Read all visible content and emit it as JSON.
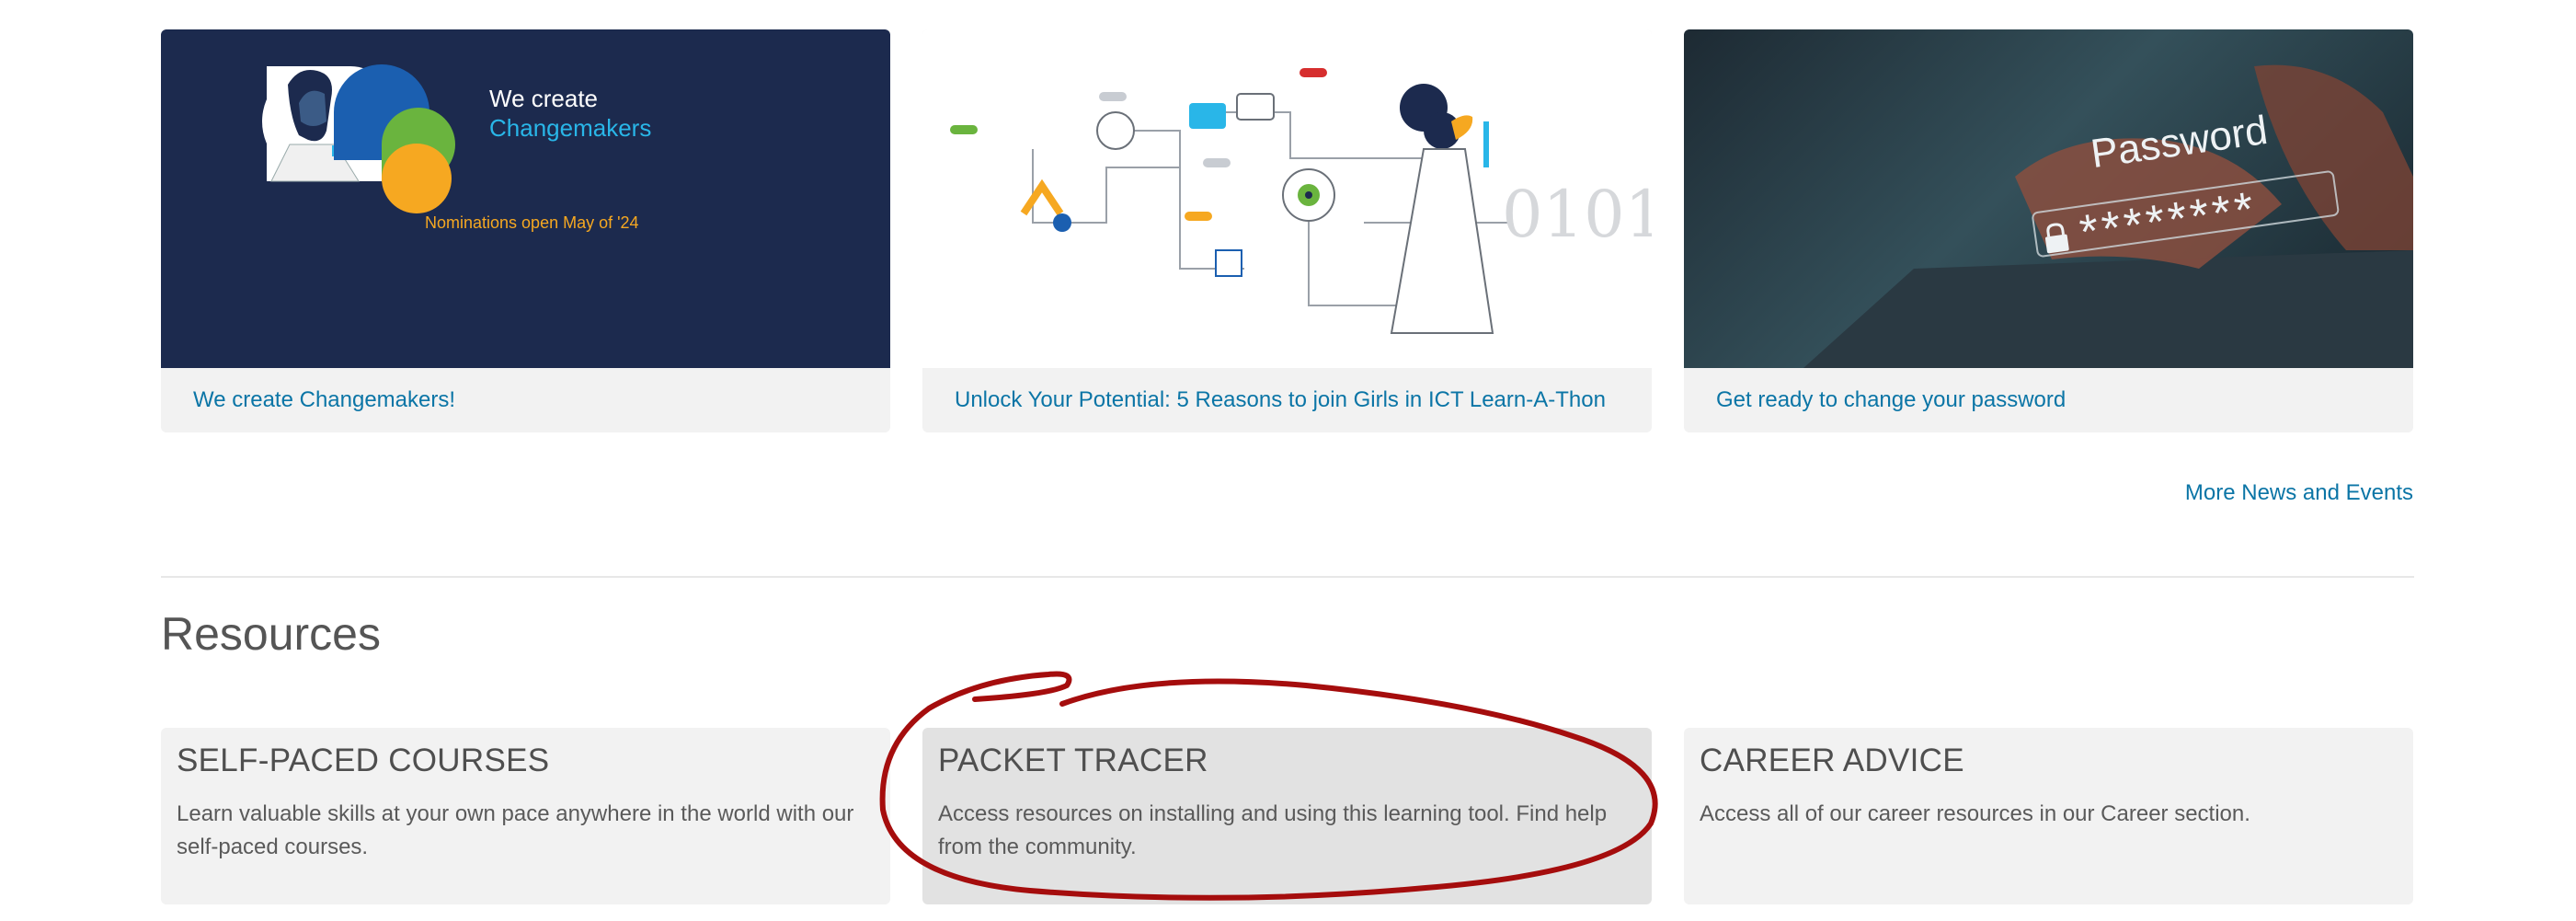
{
  "news": {
    "cards": [
      {
        "caption": "We create Changemakers!",
        "banner_line1": "We create",
        "banner_line2": "Changemakers",
        "banner_footer": "Nominations open May of '24"
      },
      {
        "caption": "Unlock Your Potential: 5 Reasons to join Girls in ICT Learn-A-Thon",
        "illustration_text": "0101"
      },
      {
        "caption": "Get ready to change your password",
        "image_word": "Password",
        "image_mask": "********"
      }
    ],
    "more_link": "More News and Events"
  },
  "resources": {
    "title": "Resources",
    "cards": [
      {
        "title": "SELF-PACED COURSES",
        "description": "Learn valuable skills at your own pace anywhere in the world with our self-paced courses."
      },
      {
        "title": "PACKET TRACER",
        "description": "Access resources on installing and using this learning tool. Find help from the community."
      },
      {
        "title": "CAREER ADVICE",
        "description": "Access all of our career resources in our Career section."
      }
    ]
  },
  "colors": {
    "link": "#0b75a6",
    "banner_navy": "#1c2a4e",
    "banner_cyan": "#29b6e8",
    "banner_gold": "#f6a821",
    "annotation_red": "#a50d0d"
  },
  "icons": [
    "lock-icon"
  ]
}
